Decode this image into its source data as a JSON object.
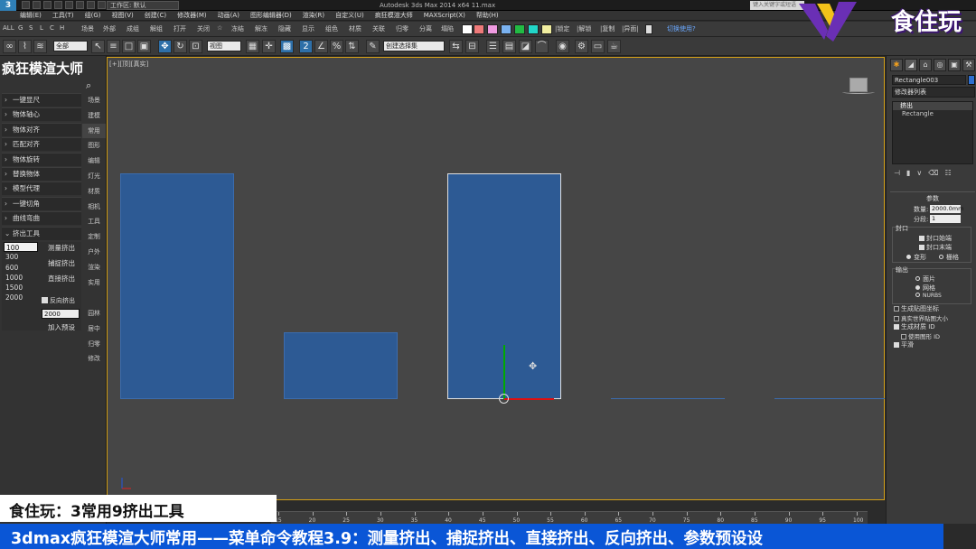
{
  "titlebar": {
    "workspace": "工作区: 默认",
    "app_title": "Autodesk 3ds Max  2014 x64    11.max",
    "search_placeholder": "键入关键字或短语"
  },
  "menu": [
    "编辑(E)",
    "工具(T)",
    "组(G)",
    "视图(V)",
    "创建(C)",
    "修改器(M)",
    "动画(A)",
    "图形编辑器(D)",
    "渲染(R)",
    "自定义(U)",
    "疯狂模渲大师",
    "MAXScript(X)",
    "帮助(H)"
  ],
  "toolbar1": {
    "items": [
      "ALL",
      "G",
      "S",
      "L",
      "C",
      "H",
      "场景",
      "外部",
      "成组",
      "解组",
      "打开",
      "关闭",
      "☆",
      "冻结",
      "解冻",
      "隐藏",
      "显示",
      "组色",
      "材质",
      "关联",
      "归零",
      "分离",
      "塌陷"
    ],
    "labels_right": [
      "|锁定",
      "|解锁",
      "|复制",
      "|异面|"
    ],
    "tail": "切换使用?",
    "swatches": [
      "#ef7a7a",
      "#ef9ae0",
      "#7ab2f0",
      "#22bb44",
      "#22d6c8",
      "#f1eea0"
    ]
  },
  "toolbar2": {
    "filter": "全部",
    "view": "视图",
    "selection_set": "创建选择集"
  },
  "left_panel": {
    "title": "疯狂模渲大师",
    "categories": [
      "一键显尺",
      "物体轴心",
      "物体对齐",
      "匹配对齐",
      "物体旋转",
      "替换物体",
      "模型代理",
      "一键切角",
      "曲线弯曲",
      "挤出工具"
    ],
    "values": [
      "100",
      "300",
      "600",
      "1000",
      "1500",
      "2000"
    ],
    "buttons": [
      "测量挤出",
      "捕捉挤出",
      "直接挤出"
    ],
    "reverse_label": "反向挤出",
    "preset_value": "2000",
    "add_preset": "加入预设",
    "side_tabs": [
      "场景",
      "建模",
      "常用",
      "图形",
      "编辑",
      "灯光",
      "材质",
      "相机",
      "工具",
      "定制",
      "户外",
      "渲染",
      "实用"
    ],
    "side_tabs2": [
      "园林",
      "居中",
      "归零",
      "修改"
    ]
  },
  "viewport": {
    "label": "[+][顶][真实]"
  },
  "command_panel": {
    "object_name": "Rectangle003",
    "modifier_list": "修改器列表",
    "stack": [
      "挤出",
      "Rectangle"
    ],
    "params_header": "参数",
    "amount_label": "数量:",
    "amount_value": "2000.0mm",
    "segments_label": "分段:",
    "segments_value": "1",
    "capping_label": "封口",
    "cap_start": "封口始端",
    "cap_end": "封口末端",
    "morph": "变形",
    "grid": "栅格",
    "output_label": "输出",
    "patch": "面片",
    "mesh": "网格",
    "nurbs": "NURBS",
    "gen_mapping": "生成贴图坐标",
    "real_world": "真实世界贴图大小",
    "gen_mat_ids": "生成材质 ID",
    "use_shape_ids": "使用图形 ID",
    "smooth": "平滑",
    "color": "#2e6fd0"
  },
  "timeline": {
    "ticks": [
      "15",
      "20",
      "25",
      "30",
      "35",
      "40",
      "45",
      "50",
      "55",
      "60",
      "65",
      "70",
      "75",
      "80",
      "85",
      "90",
      "95",
      "100"
    ]
  },
  "overlay": {
    "brand": "食住玩",
    "subtitle": "食住玩：3常用9挤出工具",
    "banner": "3dmax疯狂模渲大师常用——菜单命令教程3.9：测量挤出、捕捉挤出、直接挤出、反向挤出、参数预设设"
  }
}
